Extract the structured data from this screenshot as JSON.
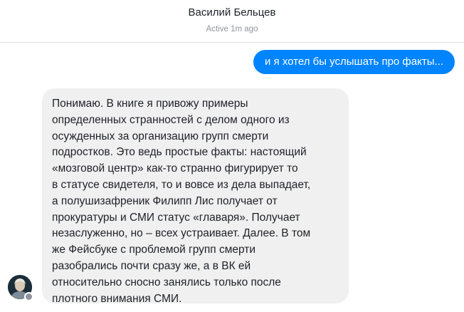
{
  "header": {
    "contact_name": "Василий Бельцев",
    "status": "Active 1m ago"
  },
  "messages": {
    "outgoing": {
      "text": "и я хотел бы услышать про факты...",
      "color": "#0084ff"
    },
    "incoming": {
      "lines": [
        "Понимаю. В книге я привожу примеры",
        "определенных странностей с делом одного из",
        "осужденных за организацию групп смерти",
        "подростков. Это ведь простые факты: настоящий",
        "«мозговой центр» как-то странно фигурирует то",
        "в статусе свидетеля, то и вовсе из дела выпадает,",
        "а полушизафреник Филипп Лис получает от",
        "прокуратуры и СМИ статус «главаря». Получает",
        "незаслуженно, но – всех устраивает. Далее. В том",
        "же Фейсбуке с проблемой групп смерти",
        "разобрались почти сразу же, а в ВК ей",
        "относительно сносно занялись только после",
        "плотного внимания СМИ."
      ],
      "color": "#f1f0f0"
    }
  },
  "contact": {
    "avatar_icon": "user-avatar-photo",
    "badge_icon": "facebook-badge-icon"
  }
}
